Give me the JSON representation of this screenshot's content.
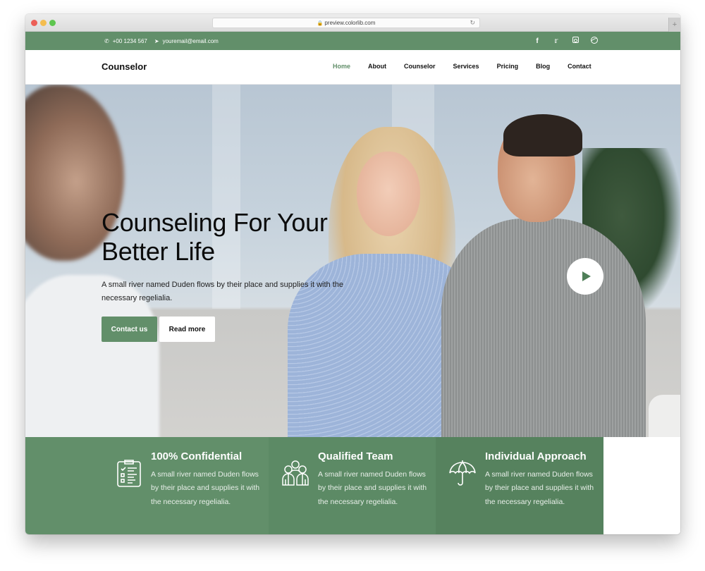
{
  "browser": {
    "url": "preview.colorlib.com",
    "new_tab_label": "+"
  },
  "topbar": {
    "phone": "+00 1234 567",
    "email": "youremail@email.com",
    "social": [
      "facebook",
      "twitter",
      "instagram",
      "dribbble"
    ]
  },
  "nav": {
    "brand": "Counselor",
    "items": [
      {
        "label": "Home",
        "active": true
      },
      {
        "label": "About"
      },
      {
        "label": "Counselor"
      },
      {
        "label": "Services"
      },
      {
        "label": "Pricing"
      },
      {
        "label": "Blog"
      },
      {
        "label": "Contact"
      }
    ]
  },
  "hero": {
    "title_line1": "Counseling For Your",
    "title_line2": "Better Life",
    "subtitle": "A small river named Duden flows by their place and supplies it with the necessary regelialia.",
    "primary_button": "Contact us",
    "secondary_button": "Read more"
  },
  "features": [
    {
      "icon": "clipboard-checklist",
      "title": "100% Confidential",
      "text": "A small river named Duden flows by their place and supplies it with the necessary regelialia."
    },
    {
      "icon": "team-group",
      "title": "Qualified Team",
      "text": "A small river named Duden flows by their place and supplies it with the necessary regelialia."
    },
    {
      "icon": "umbrella",
      "title": "Individual Approach",
      "text": "A small river named Duden flows by their place and supplies it with the necessary regelialia."
    }
  ],
  "colors": {
    "accent": "#628f6a",
    "accent_dark": "#56825e",
    "text": "#111111"
  }
}
